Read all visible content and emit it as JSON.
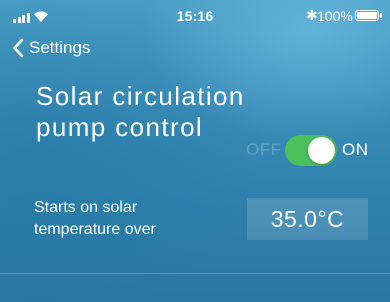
{
  "status_bar": {
    "time": "15:16",
    "battery_percent": "100%",
    "bluetooth_glyph": "✱",
    "signal_icon": "cellular-signal-icon",
    "wifi_icon": "wifi-icon",
    "battery_icon": "battery-icon"
  },
  "nav": {
    "back_label": "Settings",
    "back_icon": "chevron-left-icon"
  },
  "page": {
    "title_line1": "Solar circulation",
    "title_line2": "pump control"
  },
  "toggle": {
    "off_label": "OFF",
    "on_label": "ON",
    "state": "on",
    "color_on": "#4cc05a"
  },
  "setting": {
    "label_line1": "Starts on solar",
    "label_line2": "temperature over",
    "value": "35.0°C"
  }
}
